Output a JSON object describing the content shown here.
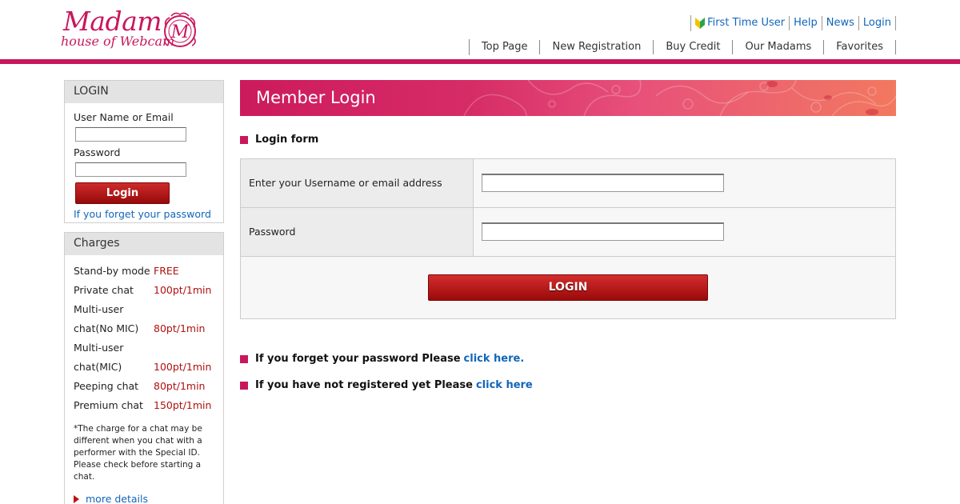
{
  "header": {
    "logo_main": "Madam",
    "logo_sub": "house of Webcam",
    "logo_emblem_letter": "M",
    "brand_color": "#c8185c",
    "top_links": [
      {
        "label": "First Time User",
        "icon": "beginner-leaf-icon"
      },
      {
        "label": "Help"
      },
      {
        "label": "News"
      },
      {
        "label": "Login"
      }
    ],
    "nav": [
      "Top Page",
      "New Registration",
      "Buy Credit",
      "Our Madams",
      "Favorites"
    ]
  },
  "sidebar_login": {
    "title": "LOGIN",
    "username_label": "User Name or Email",
    "username_value": "",
    "password_label": "Password",
    "password_value": "",
    "button_label": "Login",
    "forgot_link": "If you forget your password"
  },
  "charges": {
    "title": "Charges",
    "rows": [
      {
        "name": "Stand-by mode",
        "value": "FREE"
      },
      {
        "name": "Private chat",
        "value": "100pt/1min"
      },
      {
        "name": "Multi-user",
        "value": ""
      },
      {
        "name": "chat(No MIC)",
        "value": "80pt/1min"
      },
      {
        "name": "Multi-user",
        "value": ""
      },
      {
        "name": "chat(MIC)",
        "value": "100pt/1min"
      },
      {
        "name": "Peeping chat",
        "value": "80pt/1min"
      },
      {
        "name": "Premium chat",
        "value": "150pt/1min"
      }
    ],
    "note": "*The charge for a chat may be different when you chat with a performer with the Special ID. Please check before starting a chat.",
    "more_link": "more details"
  },
  "main": {
    "banner_title": "Member Login",
    "form_heading": "Login form",
    "username_label": "Enter your Username or email address",
    "username_value": "",
    "password_label": "Password",
    "password_value": "",
    "login_button": "LOGIN",
    "forgot_text": "If you forget your password Please",
    "forgot_link": "click here.",
    "register_text": "If you have not registered yet Please",
    "register_link": "click here"
  }
}
